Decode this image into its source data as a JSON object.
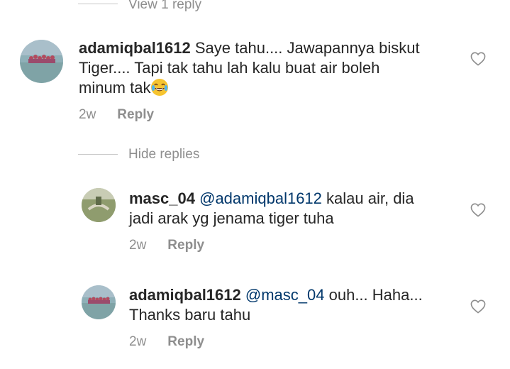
{
  "thread_toggles": {
    "view_replies": "View 1 reply",
    "hide_replies": "Hide replies"
  },
  "comments": [
    {
      "username": "adamiqbal1612",
      "mention": "",
      "text_line1": "Saye tahu.... Jawapannya biskut",
      "text_line2": "Tiger.... Tapi tak tahu lah kalu buat air boleh",
      "text_line3": "minum tak",
      "emoji": "😂",
      "time": "2w",
      "reply_label": "Reply"
    },
    {
      "username": "masc_04",
      "mention": "@adamiqbal1612",
      "text_line1": "kalau air, dia",
      "text_line2": "jadi arak yg jenama tiger tuha",
      "time": "2w",
      "reply_label": "Reply"
    },
    {
      "username": "adamiqbal1612",
      "mention": "@masc_04",
      "text_line1": "ouh... Haha...",
      "text_line2": "Thanks baru tahu",
      "time": "2w",
      "reply_label": "Reply"
    }
  ],
  "icons": {
    "like": "heart-outline-icon",
    "emoji": "face-with-tears-of-joy"
  },
  "colors": {
    "mention": "#00376b",
    "meta": "#8e8e8e",
    "text": "#262626"
  }
}
